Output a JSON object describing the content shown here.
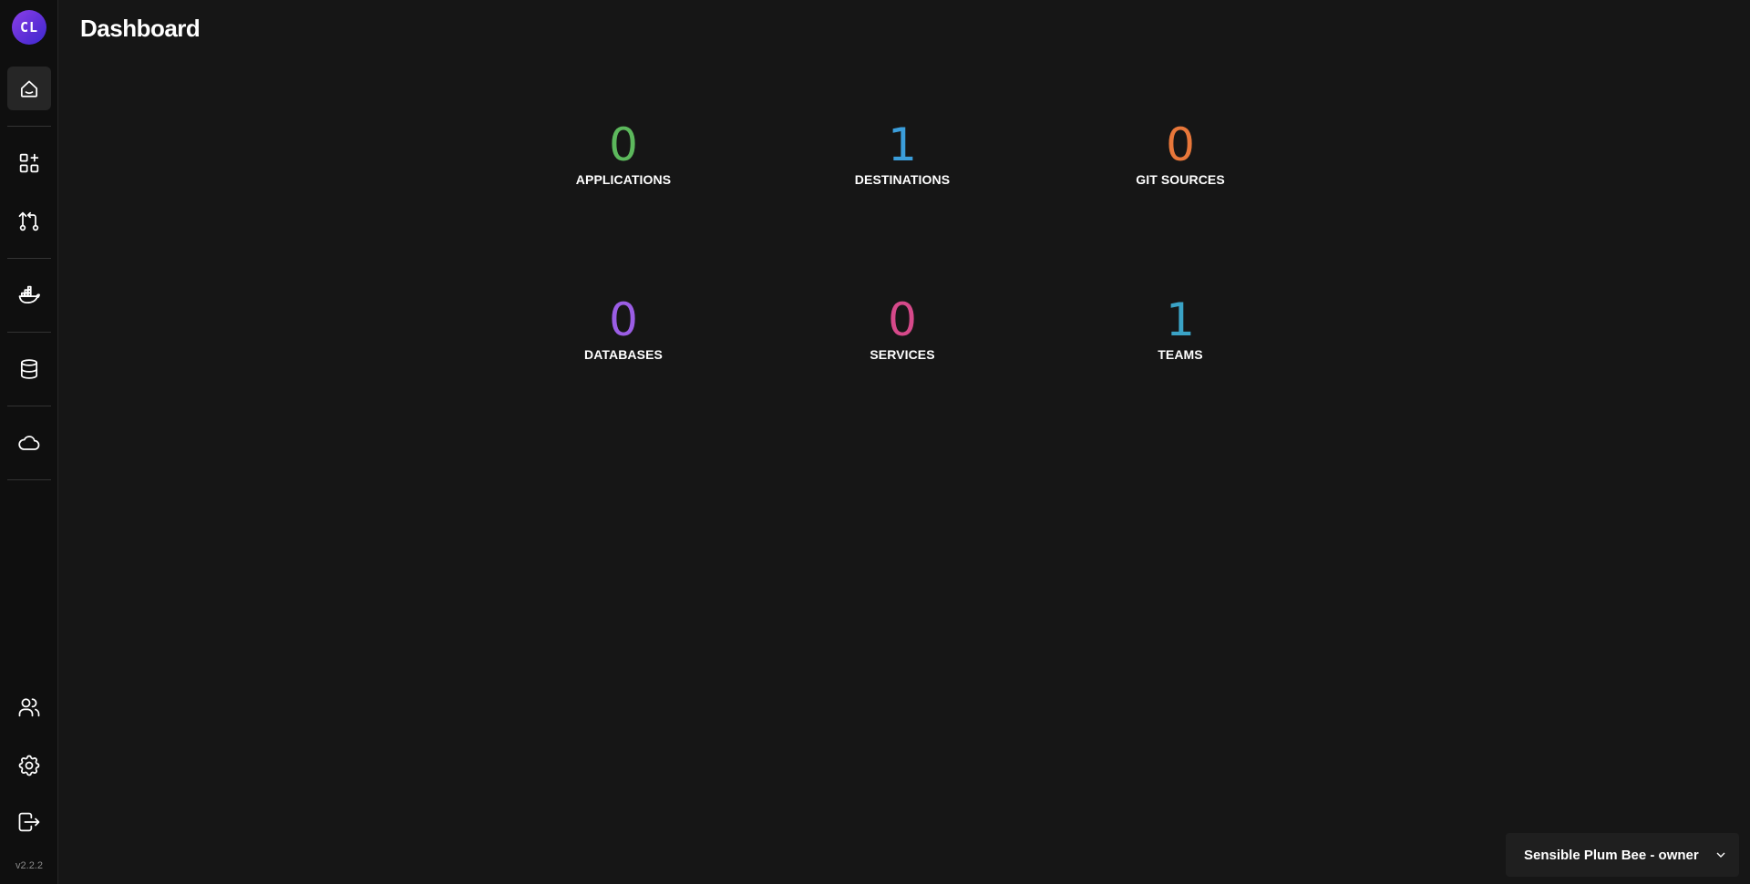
{
  "sidebar": {
    "avatar_initials": "CL",
    "version": "v2.2.2",
    "items": [
      {
        "name": "dashboard",
        "icon": "home-icon"
      },
      {
        "name": "applications",
        "icon": "apps-add-icon"
      },
      {
        "name": "git-sources",
        "icon": "git-pull-request-icon"
      },
      {
        "name": "destinations",
        "icon": "docker-icon"
      },
      {
        "name": "databases",
        "icon": "database-icon"
      },
      {
        "name": "services",
        "icon": "cloud-icon"
      },
      {
        "name": "teams",
        "icon": "users-icon"
      },
      {
        "name": "settings",
        "icon": "gear-icon"
      },
      {
        "name": "logout",
        "icon": "logout-icon"
      }
    ]
  },
  "header": {
    "title": "Dashboard"
  },
  "stats": [
    {
      "value": "0",
      "label": "APPLICATIONS",
      "color": "#5cb85c"
    },
    {
      "value": "1",
      "label": "DESTINATIONS",
      "color": "#3b9edb"
    },
    {
      "value": "0",
      "label": "GIT SOURCES",
      "color": "#e8773a"
    },
    {
      "value": "0",
      "label": "DATABASES",
      "color": "#9b5de5"
    },
    {
      "value": "0",
      "label": "SERVICES",
      "color": "#d6498a"
    },
    {
      "value": "1",
      "label": "TEAMS",
      "color": "#3aa3c6"
    }
  ],
  "team_selector": {
    "selected": "Sensible Plum Bee - owner"
  }
}
